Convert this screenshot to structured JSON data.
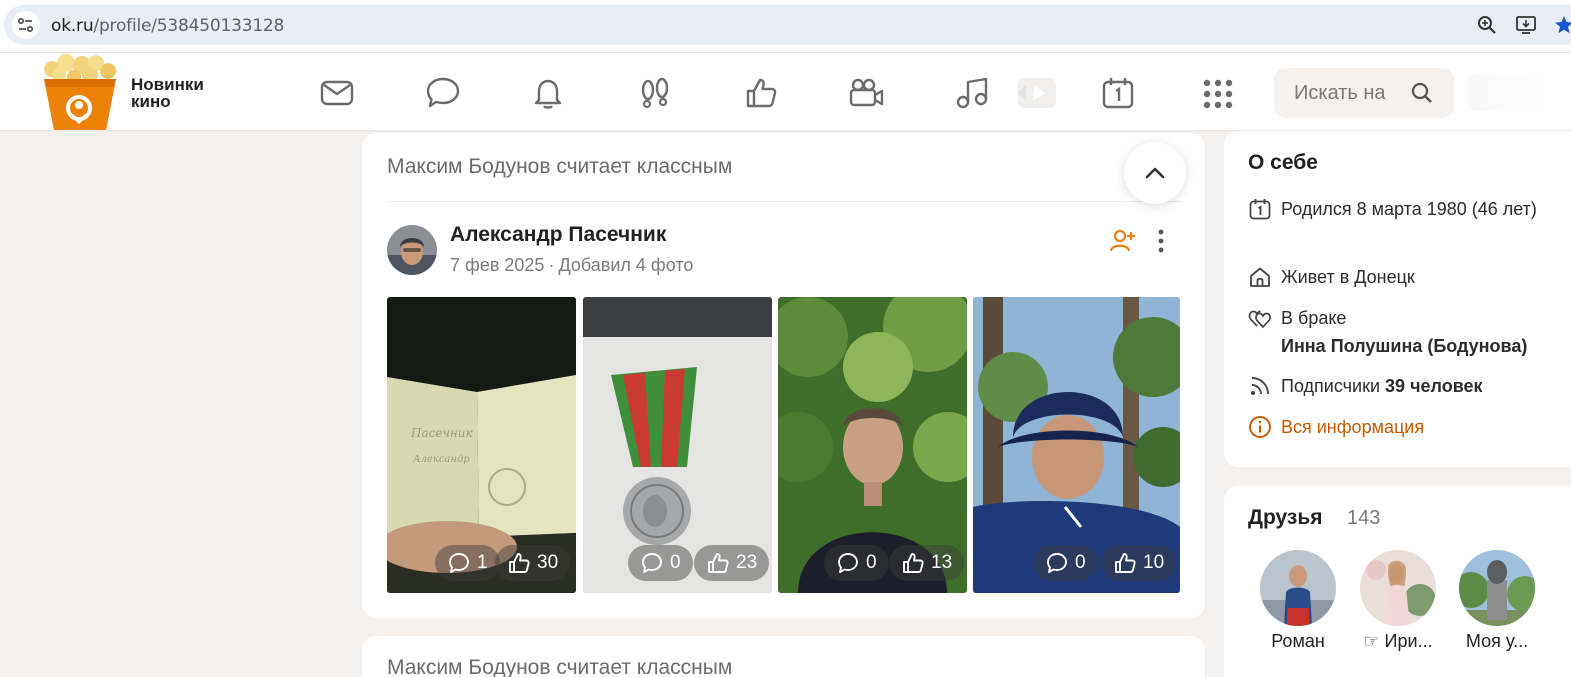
{
  "browser": {
    "url_host": "ok.ru",
    "url_path": "/profile/538450133128"
  },
  "header": {
    "promo_label_line1": "Новинки",
    "promo_label_line2": "кино",
    "nav_icons": [
      "messages-icon",
      "discussions-icon",
      "notifications-icon",
      "guests-icon",
      "likes-icon",
      "video-icon",
      "music-icon",
      "video-chip-icon",
      "calendar-icon",
      "apps-icon"
    ],
    "search_placeholder": "Искать на"
  },
  "feed": {
    "card_title": "Максим Бодунов считает классным",
    "post": {
      "author": "Александр Пасечник",
      "date": "7 фев 2025",
      "separator": "·",
      "action": "Добавил 4 фото",
      "photos": [
        {
          "comments": "1",
          "likes": "30"
        },
        {
          "comments": "0",
          "likes": "23"
        },
        {
          "comments": "0",
          "likes": "13"
        },
        {
          "comments": "0",
          "likes": "10"
        }
      ]
    },
    "next_card_title": "Максим Бодунов считает классным"
  },
  "about": {
    "title": "О себе",
    "born": "Родился 8 марта 1980 (46 лет)",
    "lives": "Живет в Донецк",
    "marital_label": "В браке",
    "spouse": "Инна Полушина (Бодунова)",
    "subscribers_label": "Подписчики",
    "subscribers_value": "39 человек",
    "all_info": "Вся информация"
  },
  "friends": {
    "title": "Друзья",
    "count": "143",
    "items": [
      {
        "name": "Роман"
      },
      {
        "name": "☞ Ири..."
      },
      {
        "name": "Моя у..."
      }
    ]
  },
  "colors": {
    "accent_orange": "#ee8208",
    "link_orange": "#c55b00",
    "page_bg": "#f4f1ef"
  }
}
